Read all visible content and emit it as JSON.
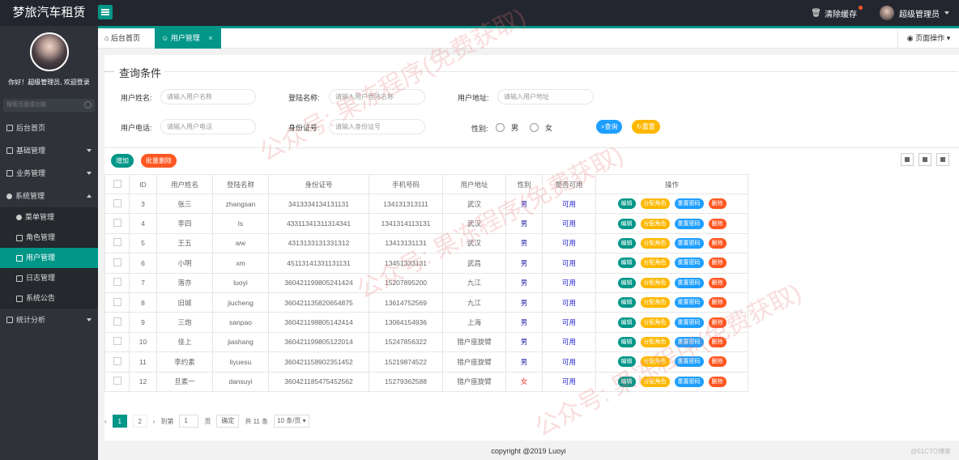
{
  "app": {
    "title": "梦旅汽车租赁"
  },
  "header": {
    "clear_cache": "清除缓存",
    "user_name": "超级管理员"
  },
  "sidebar": {
    "greeting": "你好！超级管理员, 欢迎登录",
    "search_placeholder": "搜索页面或功能",
    "items": [
      {
        "label": "后台首页"
      },
      {
        "label": "基础管理"
      },
      {
        "label": "业务管理"
      },
      {
        "label": "系统管理"
      },
      {
        "label": "菜单管理"
      },
      {
        "label": "角色管理"
      },
      {
        "label": "用户管理"
      },
      {
        "label": "日志管理"
      },
      {
        "label": "系统公告"
      },
      {
        "label": "统计分析"
      }
    ]
  },
  "tabs": {
    "home": "后台首页",
    "active": "用户管理",
    "close": "×",
    "page_ops": "页面操作"
  },
  "query": {
    "title": "查询条件",
    "name_label": "用户姓名:",
    "name_ph": "请输入用户名称",
    "login_label": "登陆名称:",
    "login_ph": "请输入用户登陆名称",
    "addr_label": "用户地址:",
    "addr_ph": "请输入用户地址",
    "phone_label": "用户电话:",
    "phone_ph": "请输入用户电话",
    "id_label": "身份证号:",
    "id_ph": "请输入身份证号",
    "gender_label": "性别:",
    "male": "男",
    "female": "女",
    "search_btn": "查询",
    "reset_btn": "重置"
  },
  "toolbar": {
    "add": "增加",
    "batch_delete": "批量删除"
  },
  "table": {
    "headers": [
      "",
      "ID",
      "用户姓名",
      "登陆名称",
      "身份证号",
      "手机号码",
      "用户地址",
      "性别",
      "是否可用",
      "操作"
    ],
    "actions": {
      "edit": "编辑",
      "role": "分配角色",
      "reset": "重置密码",
      "delete": "删除"
    },
    "rows": [
      {
        "id": "3",
        "name": "张三",
        "login": "zhangsan",
        "idcard": "3413334134131131",
        "phone": "134131313111",
        "addr": "武汉",
        "gender": "男",
        "avail": "可用"
      },
      {
        "id": "4",
        "name": "李四",
        "login": "ls",
        "idcard": "43311341311314341",
        "phone": "1341314113131",
        "addr": "武汉",
        "gender": "男",
        "avail": "可用"
      },
      {
        "id": "5",
        "name": "王五",
        "login": "ww",
        "idcard": "4313133131331312",
        "phone": "13413131131",
        "addr": "武汉",
        "gender": "男",
        "avail": "可用"
      },
      {
        "id": "6",
        "name": "小明",
        "login": "xm",
        "idcard": "45113141331131131",
        "phone": "13451333131",
        "addr": "武昌",
        "gender": "男",
        "avail": "可用"
      },
      {
        "id": "7",
        "name": "落亦",
        "login": "luoyi",
        "idcard": "360421199805241424",
        "phone": "15207895200",
        "addr": "九江",
        "gender": "男",
        "avail": "可用"
      },
      {
        "id": "8",
        "name": "旧城",
        "login": "jiucheng",
        "idcard": "360421135820654875",
        "phone": "13614752569",
        "addr": "九江",
        "gender": "男",
        "avail": "可用"
      },
      {
        "id": "9",
        "name": "三炮",
        "login": "sanpao",
        "idcard": "360421198805142414",
        "phone": "13064154936",
        "addr": "上海",
        "gender": "男",
        "avail": "可用"
      },
      {
        "id": "10",
        "name": "佳上",
        "login": "jiashang",
        "idcard": "360421199805122014",
        "phone": "15247856322",
        "addr": "猎户座旋臂",
        "gender": "男",
        "avail": "可用"
      },
      {
        "id": "11",
        "name": "李约素",
        "login": "liyuesu",
        "idcard": "360421158902351452",
        "phone": "15219874522",
        "addr": "猎户座旋臂",
        "gender": "男",
        "avail": "可用"
      },
      {
        "id": "12",
        "name": "旦素一",
        "login": "dansuyi",
        "idcard": "360421185475452562",
        "phone": "15279362588",
        "addr": "猎户座旋臂",
        "gender": "女",
        "avail": "可用"
      }
    ]
  },
  "pager": {
    "page1": "1",
    "page2": "2",
    "goto_label": "到第",
    "goto_value": "1",
    "page_unit": "页",
    "confirm": "确定",
    "total": "共 11 条",
    "page_size": "10 条/页"
  },
  "footer": {
    "copyright": "copyright @2019 Luoyi",
    "corner": "@51CTO博客"
  },
  "watermark": {
    "text": "公众号: 果冻程序(免费获取)"
  }
}
